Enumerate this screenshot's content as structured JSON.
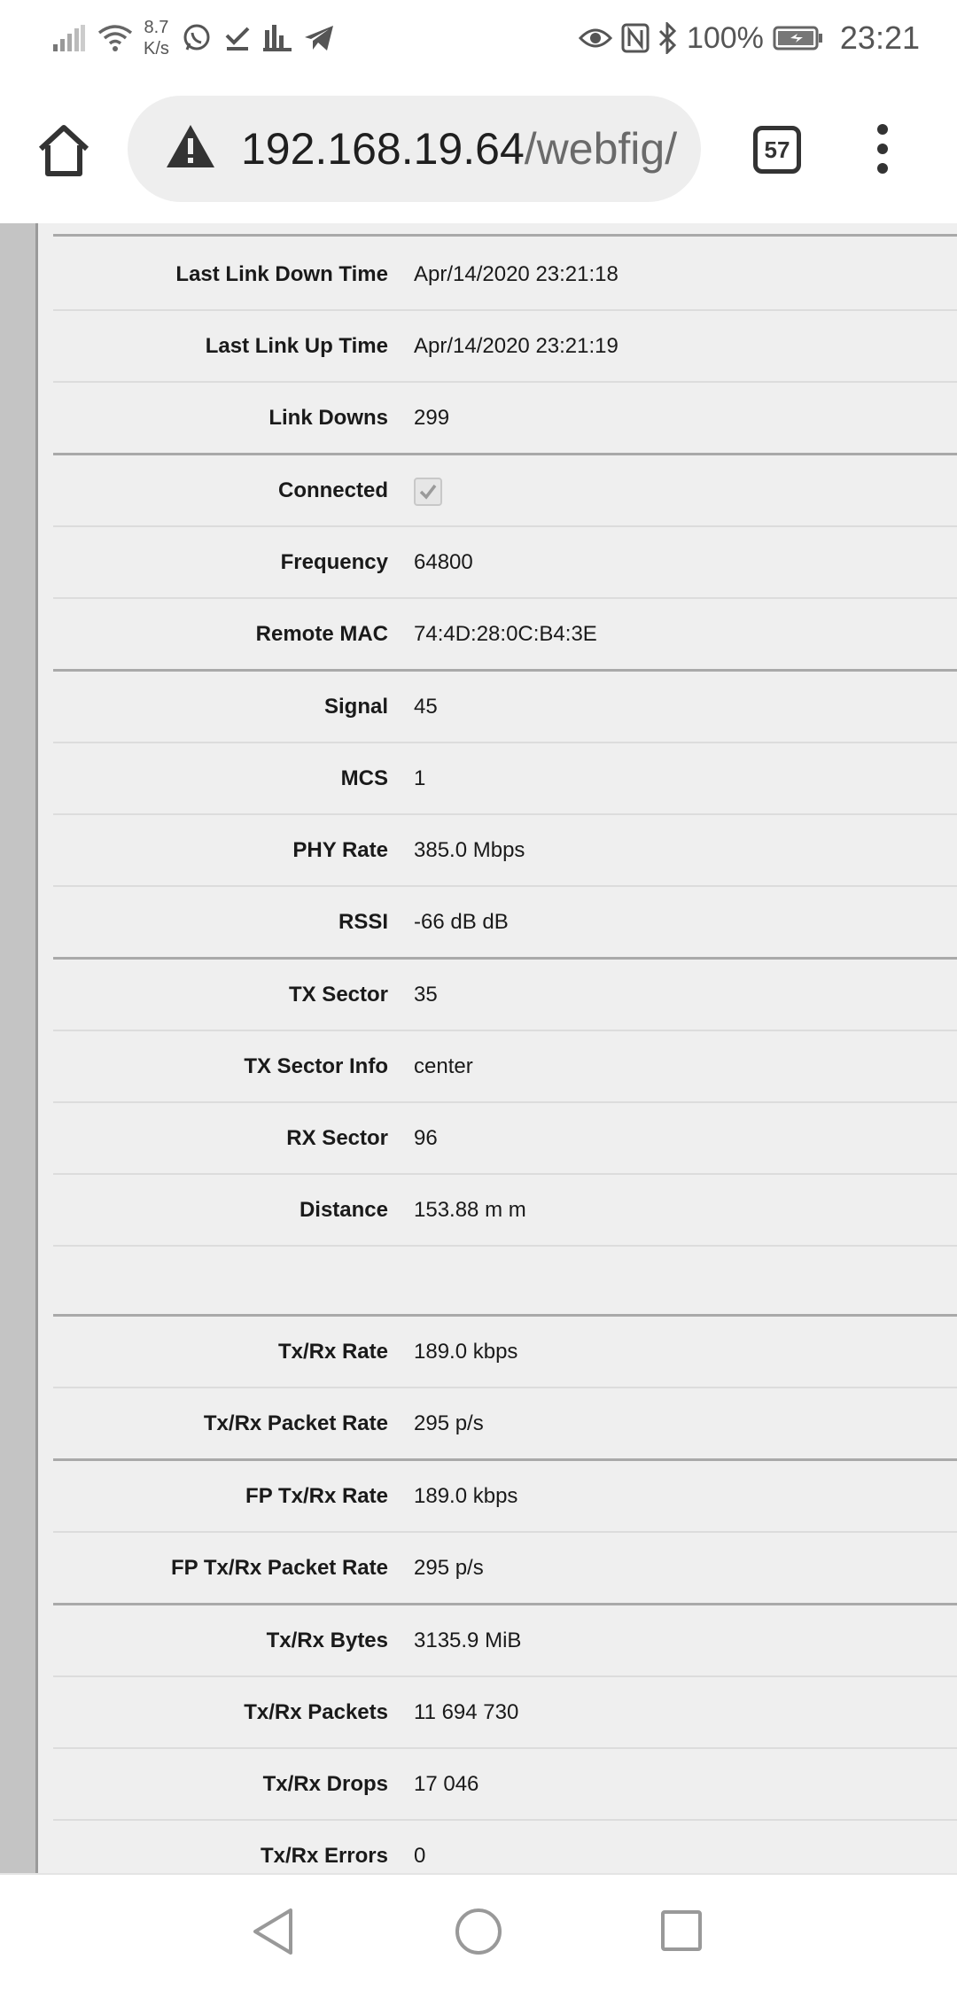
{
  "status_bar": {
    "net_speed_value": "8.7",
    "net_speed_unit": "K/s",
    "icons_left": [
      "signal-icon",
      "wifi-icon",
      "whatsapp-icon",
      "download-done-icon",
      "bar-chart-icon",
      "telegram-icon"
    ],
    "icons_right": [
      "eye-icon",
      "nfc-icon",
      "bluetooth-icon",
      "battery-icon"
    ],
    "battery": "100%",
    "time": "23:21"
  },
  "browser": {
    "url_host": "192.168.19.64",
    "url_path": "/webfig/",
    "tab_count": "57"
  },
  "table": {
    "rows": [
      {
        "label": "Last Link Down Time",
        "value": "Apr/14/2020 23:21:18",
        "group_end": false
      },
      {
        "label": "Last Link Up Time",
        "value": "Apr/14/2020 23:21:19",
        "group_end": false
      },
      {
        "label": "Link Downs",
        "value": "299",
        "group_end": true
      },
      {
        "label": "Connected",
        "value": "",
        "checkbox": true,
        "checked": true,
        "group_end": false
      },
      {
        "label": "Frequency",
        "value": "64800",
        "group_end": false
      },
      {
        "label": "Remote MAC",
        "value": "74:4D:28:0C:B4:3E",
        "group_end": true
      },
      {
        "label": "Signal",
        "value": "45",
        "group_end": false
      },
      {
        "label": "MCS",
        "value": "1",
        "group_end": false
      },
      {
        "label": "PHY Rate",
        "value": "385.0 Mbps",
        "group_end": false
      },
      {
        "label": "RSSI",
        "value": "-66 dB dB",
        "group_end": true
      },
      {
        "label": "TX Sector",
        "value": "35",
        "group_end": false
      },
      {
        "label": "TX Sector Info",
        "value": "center",
        "group_end": false
      },
      {
        "label": "RX Sector",
        "value": "96",
        "group_end": false
      },
      {
        "label": "Distance",
        "value": "153.88 m m",
        "group_end": false
      },
      {
        "spacer": true
      },
      {
        "label": "Tx/Rx Rate",
        "value": "189.0 kbps",
        "group_end": false
      },
      {
        "label": "Tx/Rx Packet Rate",
        "value": "295 p/s",
        "group_end": true
      },
      {
        "label": "FP Tx/Rx Rate",
        "value": "189.0 kbps",
        "group_end": false
      },
      {
        "label": "FP Tx/Rx Packet Rate",
        "value": "295 p/s",
        "group_end": true
      },
      {
        "label": "Tx/Rx Bytes",
        "value": "3135.9 MiB",
        "group_end": false
      },
      {
        "label": "Tx/Rx Packets",
        "value": "11 694 730",
        "group_end": false
      },
      {
        "label": "Tx/Rx Drops",
        "value": "17 046",
        "group_end": false
      },
      {
        "label": "Tx/Rx Errors",
        "value": "0",
        "group_end": false
      }
    ]
  },
  "nav": {
    "icons": [
      "back-icon",
      "home-circle-icon",
      "recent-apps-icon"
    ]
  }
}
